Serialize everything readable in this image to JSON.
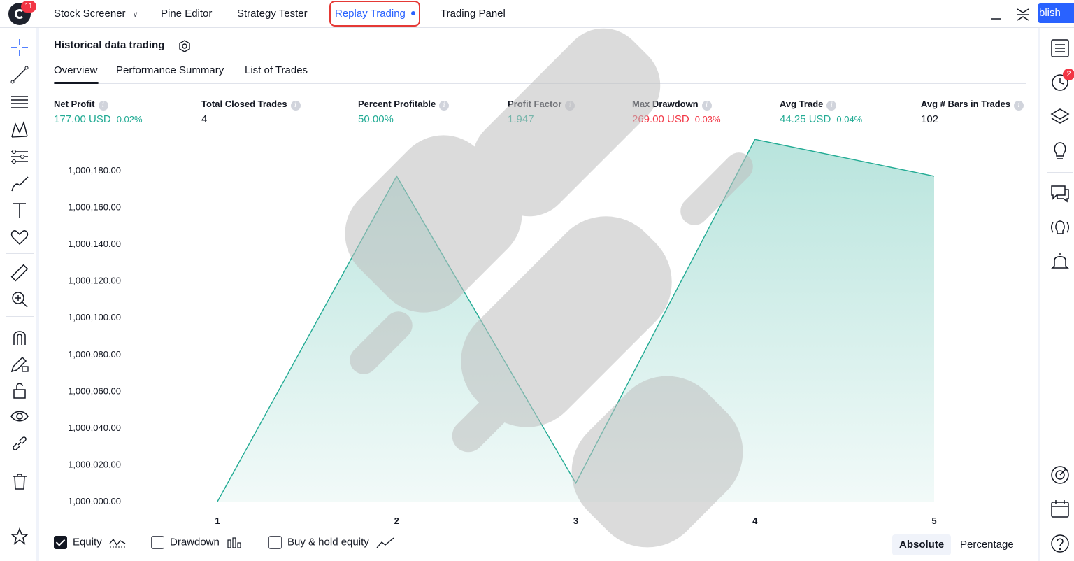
{
  "topbar": {
    "logo_badge": "11",
    "tabs": [
      {
        "label": "Stock Screener",
        "has_dropdown": true
      },
      {
        "label": "Pine Editor"
      },
      {
        "label": "Strategy Tester"
      },
      {
        "label": "Replay Trading",
        "active": true
      },
      {
        "label": "Trading Panel"
      }
    ],
    "publish_label": "blish"
  },
  "right_toolbar": {
    "alerts_badge": "2",
    "icons": [
      "watchlist-icon",
      "alerts-clock-icon",
      "layers-icon",
      "ideas-bulb-icon",
      "chat-icon",
      "streams-icon",
      "notifications-bell-icon",
      "dom-target-icon",
      "calendar-icon",
      "help-icon"
    ]
  },
  "left_toolbar": {
    "icons": [
      "crosshair-icon",
      "trend-line-icon",
      "fib-lines-icon",
      "pattern-icon",
      "forecast-icon",
      "brush-icon",
      "text-icon",
      "heart-icon",
      "ruler-icon",
      "zoom-in-icon",
      "magnet-icon",
      "lock-drawing-icon",
      "unlock-icon",
      "eye-icon",
      "link-icon",
      "trash-icon",
      "star-icon"
    ]
  },
  "panel": {
    "title": "Historical data trading",
    "subtabs": [
      "Overview",
      "Performance Summary",
      "List of Trades"
    ],
    "active_subtab": "Overview"
  },
  "metrics": [
    {
      "label": "Net Profit",
      "value": "177.00 USD",
      "pct": "0.02%",
      "color": "#22ab94"
    },
    {
      "label": "Total Closed Trades",
      "value": "4",
      "pct": "",
      "color": "#131722"
    },
    {
      "label": "Percent Profitable",
      "value": "50.00%",
      "pct": "",
      "color": "#22ab94"
    },
    {
      "label": "Profit Factor",
      "value": "1.947",
      "pct": "",
      "color": "#22ab94"
    },
    {
      "label": "Max Drawdown",
      "value": "269.00 USD",
      "pct": "0.03%",
      "color": "#f23645"
    },
    {
      "label": "Avg Trade",
      "value": "44.25 USD",
      "pct": "0.04%",
      "color": "#22ab94"
    },
    {
      "label": "Avg # Bars in Trades",
      "value": "102",
      "pct": "",
      "color": "#131722"
    }
  ],
  "chart_data": {
    "type": "area",
    "x": [
      1,
      2,
      3,
      4,
      5
    ],
    "series": [
      {
        "values": [
          1000000.0,
          1000177.0,
          1000010.0,
          1000197.0,
          1000177.0
        ],
        "color": "#22ab94"
      }
    ],
    "yticks": [
      "1,000,000.00",
      "1,000,020.00",
      "1,000,040.00",
      "1,000,060.00",
      "1,000,080.00",
      "1,000,100.00",
      "1,000,120.00",
      "1,000,140.00",
      "1,000,160.00",
      "1,000,180.00"
    ],
    "ylim": [
      1000000,
      1000180
    ],
    "grid": false
  },
  "footer": {
    "legend": [
      {
        "label": "Equity",
        "checked": true
      },
      {
        "label": "Drawdown",
        "checked": false
      },
      {
        "label": "Buy & hold equity",
        "checked": false
      }
    ],
    "modes": [
      "Absolute",
      "Percentage"
    ],
    "active_mode": "Absolute"
  }
}
